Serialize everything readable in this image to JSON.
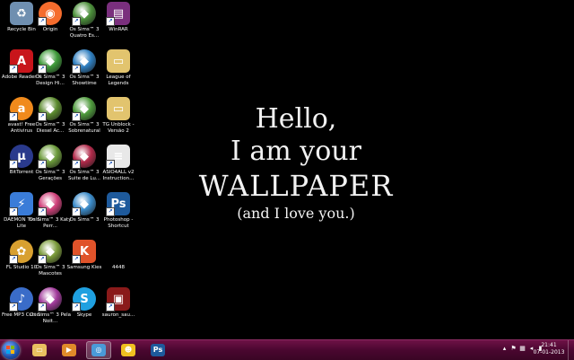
{
  "desktop": {
    "icons": [
      {
        "label": "Recycle Bin",
        "icon": "recycle-bin-icon",
        "color": "#6f8fb0"
      },
      {
        "label": "Origin",
        "icon": "origin-icon",
        "color": "#f56c2d"
      },
      {
        "label": "Os Sims™ 3 Quatro Es...",
        "icon": "sims-icon",
        "color": "#4b8f3a"
      },
      {
        "label": "WinRAR",
        "icon": "winrar-icon",
        "color": "#7a2f7d"
      },
      {
        "label": "Adobe Reader X",
        "icon": "adobe-reader-icon",
        "color": "#c8151b"
      },
      {
        "label": "Os Sims™ 3 Design Hi...",
        "icon": "sims-icon",
        "color": "#3f9a3a"
      },
      {
        "label": "Os Sims™ 3 Showtime",
        "icon": "sims-icon",
        "color": "#2f7fc0"
      },
      {
        "label": "League of Legends",
        "icon": "folder-icon",
        "color": "#e2c46e"
      },
      {
        "label": "avast! Free Antivirus",
        "icon": "avast-icon",
        "color": "#f08a1c"
      },
      {
        "label": "Os Sims™ 3 Diesel Ac...",
        "icon": "sims-icon",
        "color": "#5b8a2e"
      },
      {
        "label": "Os Sims™ 3 Sobrenatural",
        "icon": "sims-icon",
        "color": "#4e9a3c"
      },
      {
        "label": "TG Unblock - Versão 2",
        "icon": "folder-icon",
        "color": "#e2c46e"
      },
      {
        "label": "BitTorrent",
        "icon": "bittorrent-icon",
        "color": "#2a3a8c"
      },
      {
        "label": "Os Sims™ 3 Gerações",
        "icon": "sims-icon",
        "color": "#6b9a3a"
      },
      {
        "label": "Os Sims™ 3 Suite de Lu...",
        "icon": "sims-icon",
        "color": "#b02a4a"
      },
      {
        "label": "ASIO4ALL v2 Instruction...",
        "icon": "document-icon",
        "color": "#e8e8e8"
      },
      {
        "label": "DAEMON Tools Lite",
        "icon": "daemon-tools-icon",
        "color": "#3a7cd8"
      },
      {
        "label": "Os Sims™ 3 Katy Perr...",
        "icon": "sims-icon",
        "color": "#d0407a"
      },
      {
        "label": "Os Sims™ 3",
        "icon": "sims-icon",
        "color": "#3a8ac8"
      },
      {
        "label": "Photoshop - Shortcut",
        "icon": "photoshop-icon",
        "color": "#1e5a9c"
      },
      {
        "label": "FL Studio 10",
        "icon": "fl-studio-icon",
        "color": "#d8a030"
      },
      {
        "label": "Os Sims™ 3 Mascotes",
        "icon": "sims-icon",
        "color": "#7a9a3a"
      },
      {
        "label": "Samsung Kies",
        "icon": "samsung-kies-icon",
        "color": "#e0532a"
      },
      {
        "label": "4448",
        "icon": "blank-file-icon",
        "color": "#000000"
      },
      {
        "label": "Free MP3 Cutter",
        "icon": "mp3-cutter-icon",
        "color": "#3a6cc8"
      },
      {
        "label": "Os Sims™ 3 Pela Noit...",
        "icon": "sims-icon",
        "color": "#a03a9a"
      },
      {
        "label": "Skype",
        "icon": "skype-icon",
        "color": "#1fa0e0"
      },
      {
        "label": "sauron_sau...",
        "icon": "image-file-icon",
        "color": "#8a1a1a"
      }
    ]
  },
  "wallpaper": {
    "line1": "Hello,",
    "line2": "I am your",
    "line3": "WALLPAPER",
    "line4": "(and I love you.)"
  },
  "taskbar": {
    "start_icon": "windows-start-icon",
    "pinned": [
      {
        "icon": "windows-explorer-icon",
        "color": "#e8c060"
      },
      {
        "icon": "media-player-icon",
        "color": "#e08a2a"
      },
      {
        "icon": "chrome-icon",
        "color": "#4a9ad8"
      },
      {
        "icon": "messenger-icon",
        "color": "#f0c020"
      },
      {
        "icon": "photoshop-icon",
        "color": "#1e5a9c"
      }
    ],
    "tray_icons": [
      "arrow-up-icon",
      "flag-icon",
      "network-icon",
      "volume-icon",
      "battery-icon"
    ],
    "clock_time": "21:41",
    "clock_date": "07-01-2013"
  },
  "colors": {
    "taskbar": "#4a0730",
    "desktop_background": "#000000"
  }
}
